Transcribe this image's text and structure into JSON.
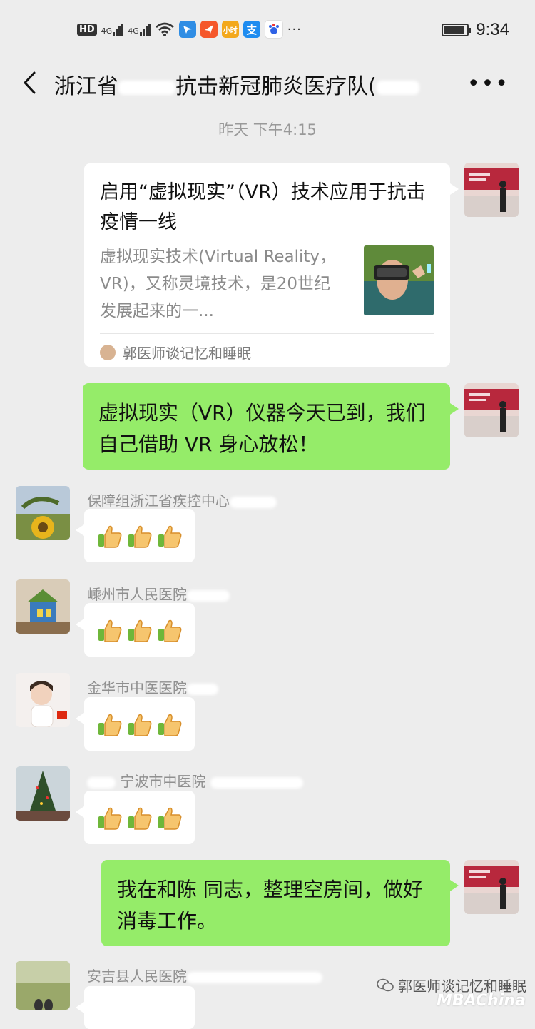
{
  "status_bar": {
    "hd_label": "HD",
    "network_1": "4G",
    "network_2": "4G",
    "app_icon_xiaoshi": "小时",
    "app_icon_alipay": "支",
    "more": "···",
    "time": "9:34"
  },
  "header": {
    "title": "浙江省",
    "title_part2": "抗击新冠肺炎医疗队(",
    "more": "•••"
  },
  "timestamp": "昨天 下午4:15",
  "card": {
    "title": "启用“虚拟现实”（VR）技术应用于抗击疫情一线",
    "description": "虚拟现实技术(Virtual Reality，VR)，又称灵境技术，是20世纪发展起来的一...",
    "source": "郭医师谈记忆和睡眠"
  },
  "messages": {
    "mine_1": "虚拟现实（VR）仪器今天已到，我们自己借助 VR 身心放松！",
    "mine_2": "我在和陈        同志，整理空房间，做好消毒工作。"
  },
  "senders": {
    "s1": "保障组浙江省疾控中心",
    "s2": "嵊州市人民医院",
    "s3": "金华市中医医院",
    "s4": "宁波市中医院",
    "s5": "安吉县人民医院"
  },
  "emoji": {
    "thumbs_count": 3
  },
  "watermark": {
    "text": "郭医师谈记忆和睡眠",
    "brand": "MBAChina"
  },
  "colors": {
    "background": "#ededed",
    "my_bubble": "#95ec69",
    "other_bubble": "#ffffff",
    "muted_text": "#999999"
  }
}
